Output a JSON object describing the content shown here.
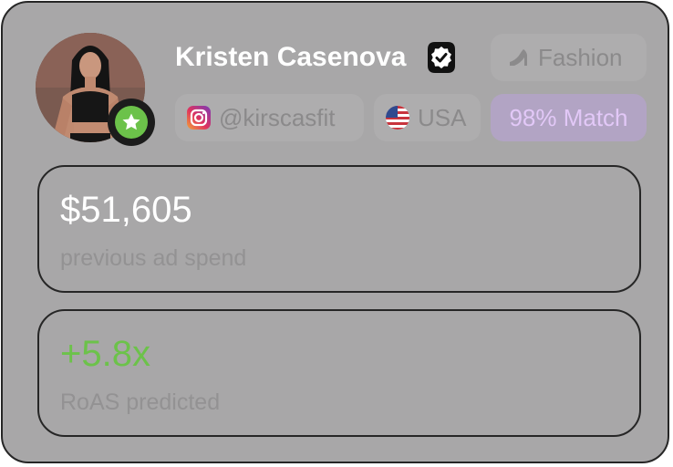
{
  "profile": {
    "name": "Kristen Casenova",
    "category": "Fashion",
    "instagram_handle": "@kirscasfit",
    "country": "USA",
    "match": "98% Match"
  },
  "stats": [
    {
      "value": "$51,605",
      "label": "previous ad spend"
    },
    {
      "value": "+5.8x",
      "label": "RoAS predicted"
    }
  ],
  "colors": {
    "card_background": "#a8a7a8",
    "border": "#262626",
    "roas_value": "#6cc24a",
    "match_background": "#b2a4c4",
    "match_text": "#e2c8f7",
    "star_badge": "#6cc24a"
  },
  "icons": {
    "verified": "verified-badge-icon",
    "category": "high-heel-icon",
    "instagram": "instagram-icon",
    "country": "us-flag-icon",
    "avatar_badge": "star-icon"
  }
}
